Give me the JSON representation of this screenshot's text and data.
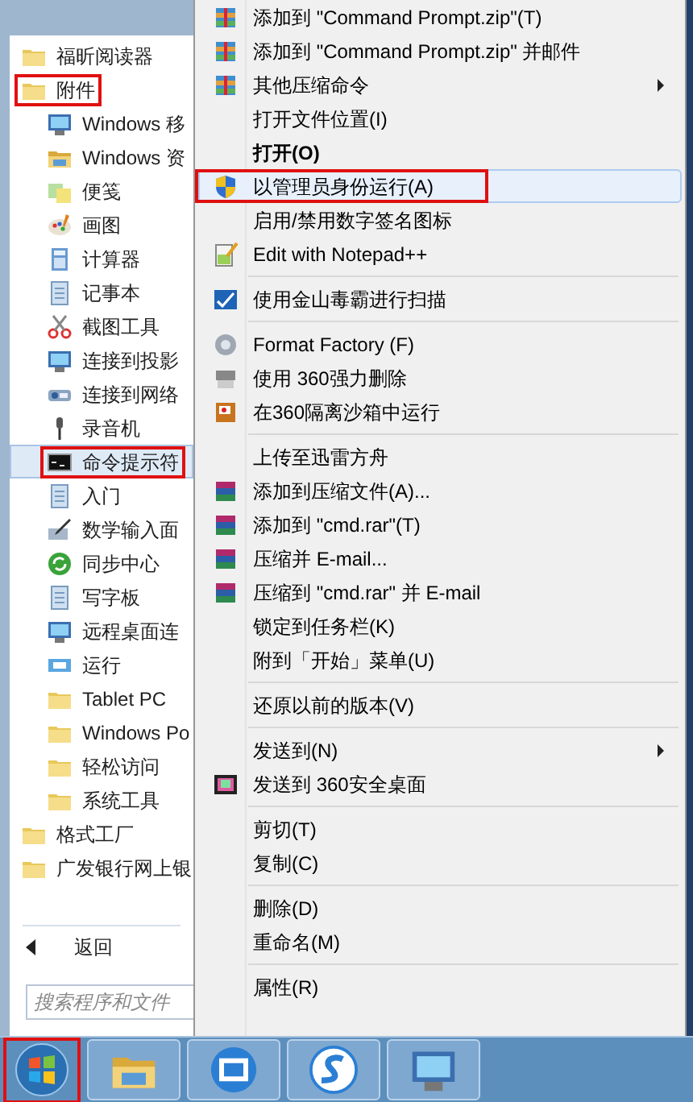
{
  "start_menu": {
    "items": [
      {
        "label": "福昕阅读器",
        "marked": false,
        "selected": false
      },
      {
        "label": "附件",
        "marked": true,
        "selected": false,
        "children": [
          {
            "label": "Windows 移",
            "marked": false,
            "selected": false
          },
          {
            "label": "Windows 资",
            "marked": false,
            "selected": false
          },
          {
            "label": "便笺",
            "marked": false,
            "selected": false
          },
          {
            "label": "画图",
            "marked": false,
            "selected": false
          },
          {
            "label": "计算器",
            "marked": false,
            "selected": false
          },
          {
            "label": "记事本",
            "marked": false,
            "selected": false
          },
          {
            "label": "截图工具",
            "marked": false,
            "selected": false
          },
          {
            "label": "连接到投影",
            "marked": false,
            "selected": false
          },
          {
            "label": "连接到网络",
            "marked": false,
            "selected": false
          },
          {
            "label": "录音机",
            "marked": false,
            "selected": false
          },
          {
            "label": "命令提示符",
            "marked": true,
            "selected": true
          },
          {
            "label": "入门",
            "marked": false,
            "selected": false
          },
          {
            "label": "数学输入面",
            "marked": false,
            "selected": false
          },
          {
            "label": "同步中心",
            "marked": false,
            "selected": false
          },
          {
            "label": "写字板",
            "marked": false,
            "selected": false
          },
          {
            "label": "远程桌面连",
            "marked": false,
            "selected": false
          },
          {
            "label": "运行",
            "marked": false,
            "selected": false
          },
          {
            "label": "Tablet PC",
            "marked": false,
            "selected": false
          },
          {
            "label": "Windows Po",
            "marked": false,
            "selected": false
          },
          {
            "label": "轻松访问",
            "marked": false,
            "selected": false
          },
          {
            "label": "系统工具",
            "marked": false,
            "selected": false
          }
        ]
      },
      {
        "label": "格式工厂",
        "marked": false,
        "selected": false
      },
      {
        "label": "广发银行网上银",
        "marked": false,
        "selected": false
      }
    ],
    "back": "返回",
    "search": {
      "placeholder": "搜索程序和文件"
    }
  },
  "context_menu": {
    "items": [
      {
        "kind": "item",
        "label": "添加到 \"Command Prompt.zip\"(T)",
        "bold": false,
        "submenu": false,
        "highlighted": false,
        "marked": false
      },
      {
        "kind": "item",
        "label": "添加到 \"Command Prompt.zip\" 并邮件",
        "bold": false,
        "submenu": false,
        "highlighted": false,
        "marked": false
      },
      {
        "kind": "item",
        "label": "其他压缩命令",
        "bold": false,
        "submenu": true,
        "highlighted": false,
        "marked": false
      },
      {
        "kind": "item",
        "label": "打开文件位置(I)",
        "bold": false,
        "submenu": false,
        "highlighted": false,
        "marked": false
      },
      {
        "kind": "item",
        "label": "打开(O)",
        "bold": true,
        "submenu": false,
        "highlighted": false,
        "marked": false
      },
      {
        "kind": "item",
        "label": "以管理员身份运行(A)",
        "bold": false,
        "submenu": false,
        "highlighted": true,
        "marked": true
      },
      {
        "kind": "item",
        "label": "启用/禁用数字签名图标",
        "bold": false,
        "submenu": false,
        "highlighted": false,
        "marked": false
      },
      {
        "kind": "item",
        "label": "Edit with Notepad++",
        "bold": false,
        "submenu": false,
        "highlighted": false,
        "marked": false
      },
      {
        "kind": "separator"
      },
      {
        "kind": "item",
        "label": "使用金山毒霸进行扫描",
        "bold": false,
        "submenu": false,
        "highlighted": false,
        "marked": false
      },
      {
        "kind": "separator"
      },
      {
        "kind": "item",
        "label": "Format Factory (F)",
        "bold": false,
        "submenu": false,
        "highlighted": false,
        "marked": false
      },
      {
        "kind": "item",
        "label": "使用 360强力删除",
        "bold": false,
        "submenu": false,
        "highlighted": false,
        "marked": false
      },
      {
        "kind": "item",
        "label": "在360隔离沙箱中运行",
        "bold": false,
        "submenu": false,
        "highlighted": false,
        "marked": false
      },
      {
        "kind": "separator"
      },
      {
        "kind": "item",
        "label": "上传至迅雷方舟",
        "bold": false,
        "submenu": false,
        "highlighted": false,
        "marked": false
      },
      {
        "kind": "item",
        "label": "添加到压缩文件(A)...",
        "bold": false,
        "submenu": false,
        "highlighted": false,
        "marked": false
      },
      {
        "kind": "item",
        "label": "添加到 \"cmd.rar\"(T)",
        "bold": false,
        "submenu": false,
        "highlighted": false,
        "marked": false
      },
      {
        "kind": "item",
        "label": "压缩并 E-mail...",
        "bold": false,
        "submenu": false,
        "highlighted": false,
        "marked": false
      },
      {
        "kind": "item",
        "label": "压缩到 \"cmd.rar\" 并 E-mail",
        "bold": false,
        "submenu": false,
        "highlighted": false,
        "marked": false
      },
      {
        "kind": "item",
        "label": "锁定到任务栏(K)",
        "bold": false,
        "submenu": false,
        "highlighted": false,
        "marked": false
      },
      {
        "kind": "item",
        "label": "附到「开始」菜单(U)",
        "bold": false,
        "submenu": false,
        "highlighted": false,
        "marked": false
      },
      {
        "kind": "separator"
      },
      {
        "kind": "item",
        "label": "还原以前的版本(V)",
        "bold": false,
        "submenu": false,
        "highlighted": false,
        "marked": false
      },
      {
        "kind": "separator"
      },
      {
        "kind": "item",
        "label": "发送到(N)",
        "bold": false,
        "submenu": true,
        "highlighted": false,
        "marked": false
      },
      {
        "kind": "item",
        "label": "发送到 360安全桌面",
        "bold": false,
        "submenu": false,
        "highlighted": false,
        "marked": false
      },
      {
        "kind": "separator"
      },
      {
        "kind": "item",
        "label": "剪切(T)",
        "bold": false,
        "submenu": false,
        "highlighted": false,
        "marked": false
      },
      {
        "kind": "item",
        "label": "复制(C)",
        "bold": false,
        "submenu": false,
        "highlighted": false,
        "marked": false
      },
      {
        "kind": "separator"
      },
      {
        "kind": "item",
        "label": "删除(D)",
        "bold": false,
        "submenu": false,
        "highlighted": false,
        "marked": false
      },
      {
        "kind": "item",
        "label": "重命名(M)",
        "bold": false,
        "submenu": false,
        "highlighted": false,
        "marked": false
      },
      {
        "kind": "separator"
      },
      {
        "kind": "item",
        "label": "属性(R)",
        "bold": false,
        "submenu": false,
        "highlighted": false,
        "marked": false
      }
    ]
  },
  "taskbar": {
    "start_marked": true
  }
}
